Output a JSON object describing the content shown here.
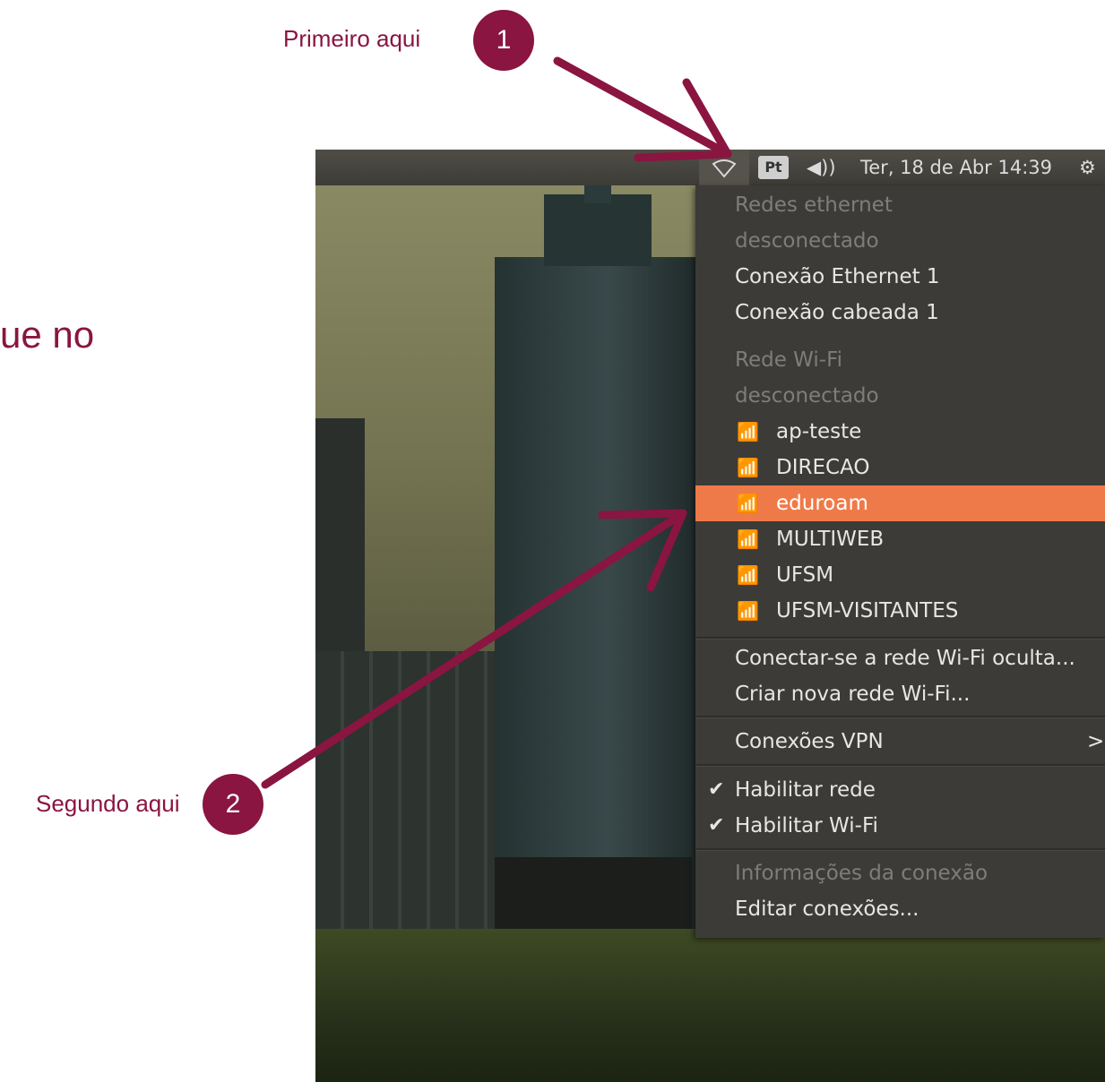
{
  "annotations": {
    "step1_label": "Primeiro aqui",
    "step1_number": "1",
    "step2_label": "Segundo aqui",
    "step2_number": "2",
    "side_text": "ue no",
    "color": "#8a1540"
  },
  "topbar": {
    "network_icon": "wifi-outline-icon",
    "language": "Pt",
    "volume_icon": "◀))",
    "clock": "Ter, 18 de Abr 14:39",
    "gear_icon": "⚙"
  },
  "menu": {
    "ethernet_header": "Redes ethernet",
    "ethernet_status": "desconectado",
    "ethernet_items": [
      "Conexão Ethernet 1",
      "Conexão cabeada 1"
    ],
    "wifi_header": "Rede Wi-Fi",
    "wifi_status": "desconectado",
    "wifi_networks": [
      "ap-teste",
      "DIRECAO",
      "eduroam",
      "MULTIWEB",
      "UFSM",
      "UFSM-VISITANTES"
    ],
    "selected_network": "eduroam",
    "hidden_network": "Conectar-se a rede Wi-Fi oculta...",
    "new_network": "Criar nova rede Wi-Fi...",
    "vpn": "Conexões VPN",
    "vpn_arrow": ">",
    "enable_network": "Habilitar rede",
    "enable_wifi": "Habilitar Wi-Fi",
    "connection_info": "Informações da conexão",
    "edit_connections": "Editar conexões...",
    "highlight_color": "#ef7a49"
  }
}
